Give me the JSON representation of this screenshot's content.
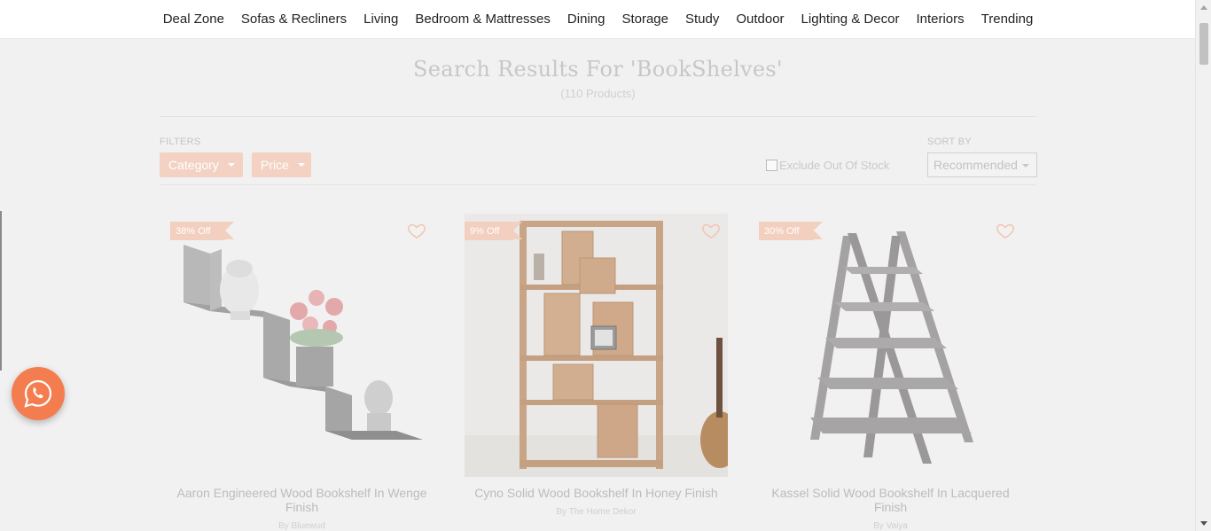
{
  "nav": [
    "Deal Zone",
    "Sofas & Recliners",
    "Living",
    "Bedroom & Mattresses",
    "Dining",
    "Storage",
    "Study",
    "Outdoor",
    "Lighting & Decor",
    "Interiors",
    "Trending"
  ],
  "search": {
    "title": "Search Results For 'BookShelves'",
    "count": "(110 Products)"
  },
  "filters": {
    "label": "FILTERS",
    "category": "Category",
    "price": "Price",
    "exclude_out_of_stock": "Exclude Out Of Stock",
    "sort_label": "SORT BY",
    "sort_value": "Recommended"
  },
  "products": [
    {
      "discount": "38% Off",
      "name": "Aaron Engineered Wood Bookshelf In Wenge Finish",
      "seller": "By Bluewud"
    },
    {
      "discount": "9% Off",
      "name": "Cyno Solid Wood Bookshelf In Honey Finish",
      "seller": "By The Home Dekor"
    },
    {
      "discount": "30% Off",
      "name": "Kassel Solid Wood Bookshelf In Lacquered Finish",
      "seller": "By Vaiya"
    }
  ],
  "colors": {
    "accent": "#f47d50",
    "badge": "#f3cfbf",
    "filter_button": "#f3d2c3"
  },
  "icons": {
    "wishlist": "heart-outline-icon",
    "chat": "whatsapp-icon"
  }
}
